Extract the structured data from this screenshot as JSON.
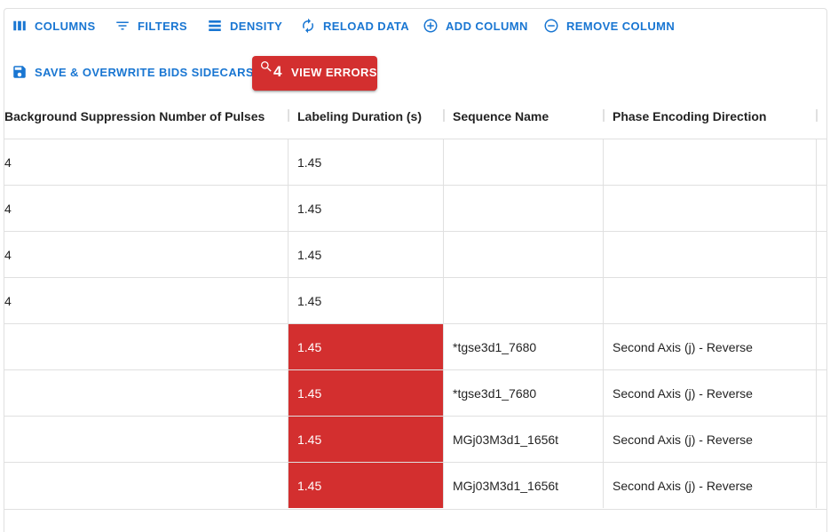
{
  "toolbar": {
    "columns_label": "COLUMNS",
    "filters_label": "FILTERS",
    "density_label": "DENSITY",
    "reload_label": "RELOAD DATA",
    "add_column_label": "ADD COLUMN",
    "remove_column_label": "REMOVE COLUMN",
    "save_label": "SAVE & OVERWRITE BIDS SIDECARS",
    "errors_count": "4",
    "errors_label": "VIEW ERRORS"
  },
  "table": {
    "headers": [
      "Background Suppression Number of Pulses",
      "Labeling Duration (s)",
      "Sequence Name",
      "Phase Encoding Direction"
    ],
    "rows": [
      {
        "pulses": "4",
        "duration": "1.45",
        "sequence": "",
        "phase": ""
      },
      {
        "pulses": "4",
        "duration": "1.45",
        "sequence": "",
        "phase": ""
      },
      {
        "pulses": "4",
        "duration": "1.45",
        "sequence": "",
        "phase": ""
      },
      {
        "pulses": "4",
        "duration": "1.45",
        "sequence": "",
        "phase": ""
      },
      {
        "pulses": "",
        "duration": "1.45",
        "sequence": "*tgse3d1_7680",
        "phase": "Second Axis (j) - Reverse"
      },
      {
        "pulses": "",
        "duration": "1.45",
        "sequence": "*tgse3d1_7680",
        "phase": "Second Axis (j) - Reverse"
      },
      {
        "pulses": "",
        "duration": "1.45",
        "sequence": "MGj03M3d1_1656t",
        "phase": "Second Axis (j) - Reverse"
      },
      {
        "pulses": "",
        "duration": "1.45",
        "sequence": "MGj03M3d1_1656t",
        "phase": "Second Axis (j) - Reverse"
      }
    ]
  },
  "icons": {
    "columns": "view-column-icon",
    "filters": "filter-list-icon",
    "density": "density-icon",
    "reload": "reload-icon",
    "add": "add-circle-icon",
    "remove": "remove-circle-icon",
    "save": "save-icon",
    "errors": "error-search-icon"
  },
  "colors": {
    "accent": "#1976d2",
    "error": "#d32f2f"
  }
}
